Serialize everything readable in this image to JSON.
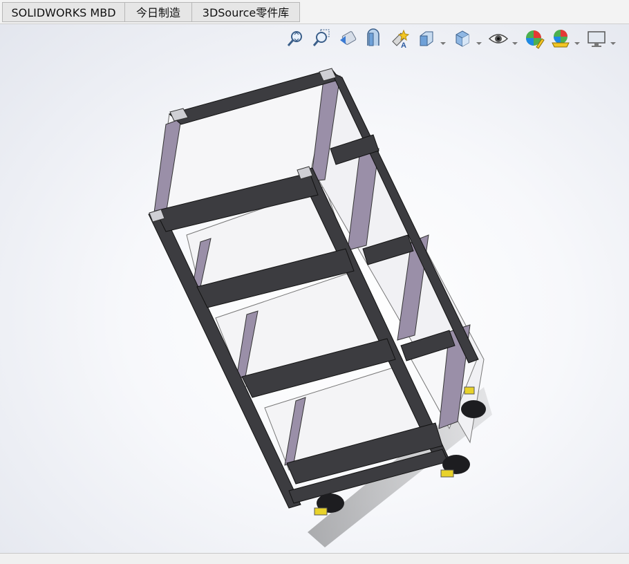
{
  "tabs": [
    {
      "label": "SOLIDWORKS MBD"
    },
    {
      "label": "今日制造"
    },
    {
      "label": "3DSource零件库"
    }
  ],
  "toolbar_icons": [
    "zoom-to-fit-icon",
    "zoom-to-area-icon",
    "previous-view-icon",
    "section-view-icon",
    "dynamic-annotation-views-icon",
    "view-orientation-icon",
    "display-style-icon",
    "hide-show-items-icon",
    "edit-appearance-icon",
    "apply-scene-icon",
    "view-settings-icon"
  ],
  "colors": {
    "frame_dark": "#3c3c40",
    "panel_purple": "#9a8fa8",
    "panel_white": "#f4f4f6",
    "caster_yellow": "#e8d22a",
    "viewport_edge": "#e3e6ee"
  }
}
